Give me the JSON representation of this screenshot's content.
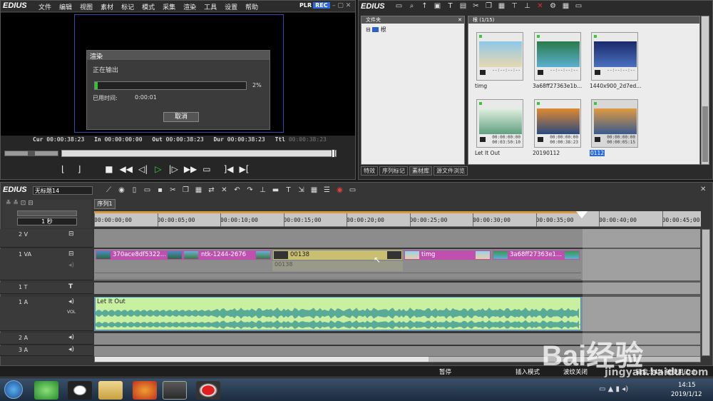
{
  "app": {
    "logo": "EDIUS",
    "plr_label": "PLR",
    "rec_label": "REC"
  },
  "menu": [
    "文件",
    "编辑",
    "视图",
    "素材",
    "标记",
    "模式",
    "采集",
    "渲染",
    "工具",
    "设置",
    "帮助"
  ],
  "render_dialog": {
    "title": "渲染",
    "status": "正在输出",
    "progress_percent": 2,
    "progress_label": "2%",
    "elapsed_label": "已用时间:",
    "elapsed_value": "0:00:01",
    "cancel": "取消"
  },
  "player": {
    "cur_label": "Cur",
    "cur": "00:00:38:23",
    "in_label": "In",
    "in": "00:00:00:00",
    "out_label": "Out",
    "out": "00:00:38:23",
    "dur_label": "Dur",
    "dur": "00:00:38:23",
    "ttl_label": "Ttl",
    "ttl": "00:00:38:23"
  },
  "bin": {
    "folder_label": "文件夹",
    "root_label": "根",
    "header": "根 (1/15)",
    "clips": [
      {
        "name": "timg",
        "tc": "--:--:--:--",
        "colors": [
          "#8ec8e8",
          "#e8d8b0"
        ]
      },
      {
        "name": "3a68ff27363e1b...",
        "tc": "--:--:--:--",
        "colors": [
          "#2a7a4a",
          "#5ab0d0"
        ]
      },
      {
        "name": "1440x900_2d7ed...",
        "tc": "--:--:--:--",
        "colors": [
          "#1a2a6a",
          "#4a70c0"
        ]
      },
      {
        "name": "Let It Out",
        "tc": "00:00:00:00",
        "tc2": "00:03:50:10",
        "colors": [
          "#e0f0e0",
          "#60a080"
        ]
      },
      {
        "name": "20190112",
        "tc": "00:00:00:00",
        "tc2": "00:00:38:23",
        "colors": [
          "#e08a30",
          "#2a4a80"
        ]
      },
      {
        "name": "0112",
        "tc": "00:00:00:00",
        "tc2": "00:00:05:15",
        "colors": [
          "#e09a40",
          "#3a5a90"
        ]
      }
    ],
    "tabs": [
      "特效",
      "序列标记",
      "素材库",
      "源文件浏览"
    ]
  },
  "timeline": {
    "project_name": "无标题14",
    "sequence_tab": "序列1",
    "scale": "1 秒",
    "ruler": [
      "00:00:00;00",
      "00:00:05;00",
      "00:00:10;00",
      "00:00:15;00",
      "00:00:20;00",
      "00:00:25;00",
      "00:00:30;00",
      "00:00:35;00",
      "00:00:40;00",
      "00:00:45;00"
    ],
    "tracks": {
      "v2": "2 V",
      "va1": "1 VA",
      "t1": "1 T",
      "a1": "1 A",
      "vol": "VOL",
      "a2": "2 A",
      "a3": "3 A"
    },
    "video_clips": [
      "370ace8df5322...",
      "ntk-1244-2676",
      "00138",
      "timg",
      "3a68ff27363e1..."
    ],
    "ghost_clip": "00138",
    "audio_clip": "Let It Out"
  },
  "status": {
    "pause": "暂停",
    "insert_mode": "插入模式",
    "ripple": "波纹关闭",
    "disk": "磁盘:54% 被使用(D:)"
  },
  "taskbar": {
    "time": "14:15",
    "date": "2019/1/12"
  },
  "watermark": {
    "text": "Bai经验",
    "url": "jingyan.baidu.com"
  },
  "colors": {
    "accent_blue": "#2a6ae0",
    "audio_green": "#c8f0a0",
    "video_pink": "#c050b0",
    "yellow_clip": "#c8c070"
  }
}
